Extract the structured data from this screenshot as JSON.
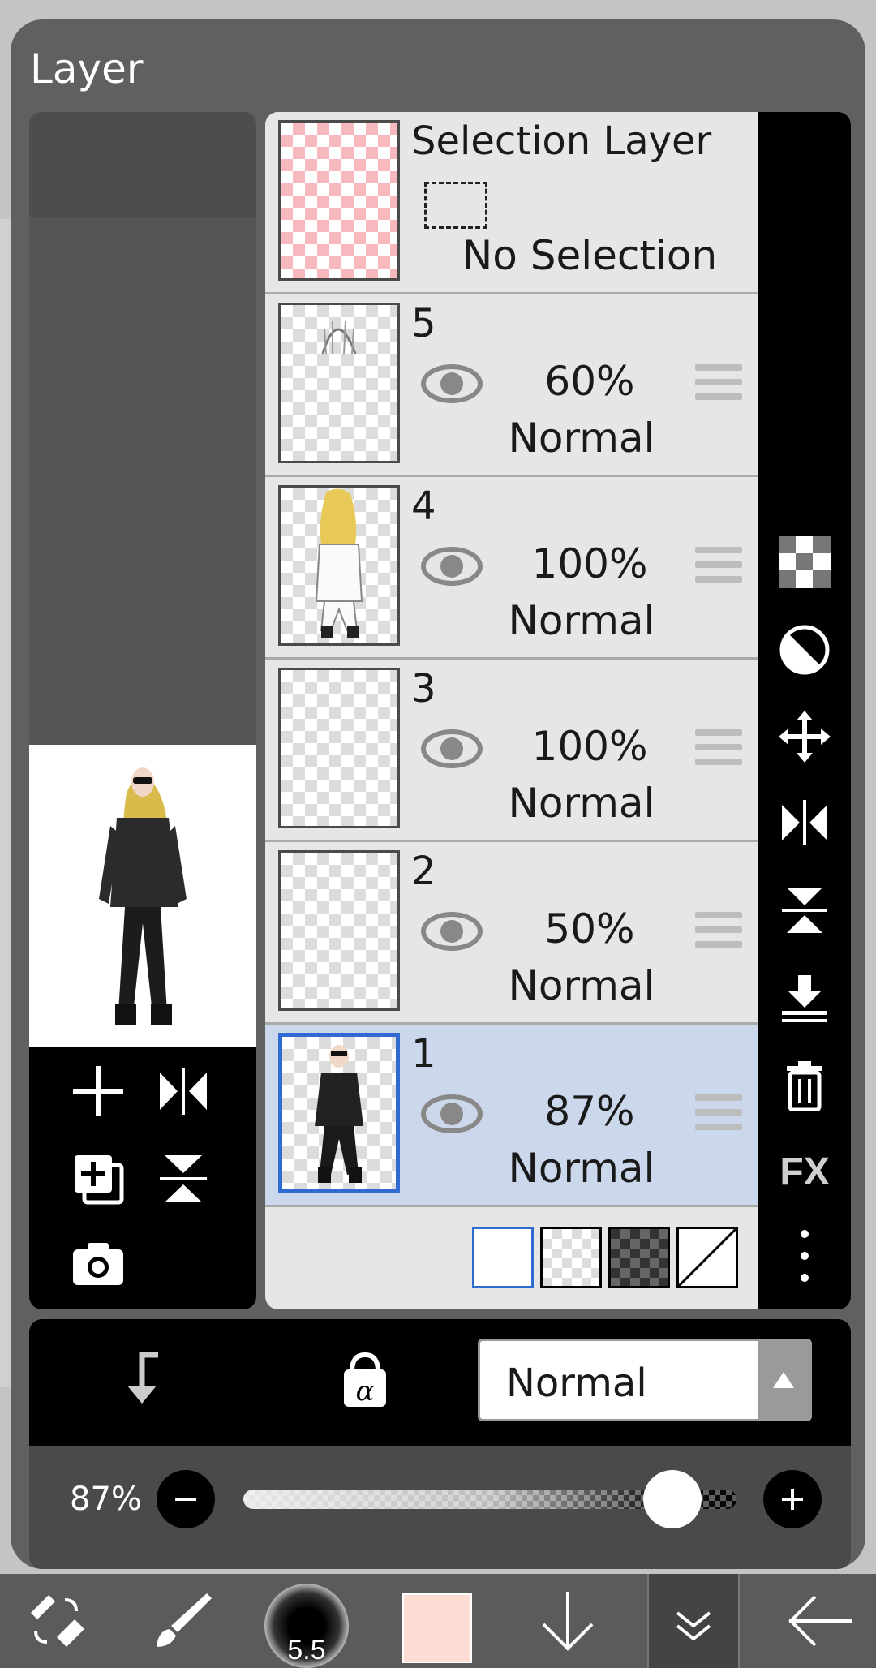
{
  "dialog": {
    "title": "Layer"
  },
  "selection_layer": {
    "title": "Selection Layer",
    "status": "No Selection"
  },
  "layers": [
    {
      "name": "5",
      "opacity": "60%",
      "blend": "Normal",
      "visible": true
    },
    {
      "name": "4",
      "opacity": "100%",
      "blend": "Normal",
      "visible": true
    },
    {
      "name": "3",
      "opacity": "100%",
      "blend": "Normal",
      "visible": true
    },
    {
      "name": "2",
      "opacity": "50%",
      "blend": "Normal",
      "visible": true
    },
    {
      "name": "1",
      "opacity": "87%",
      "blend": "Normal",
      "visible": true,
      "selected": true
    }
  ],
  "right_toolbar": {
    "fx_label": "FX"
  },
  "blend_mode": {
    "selected": "Normal"
  },
  "opacity_slider": {
    "label": "87%",
    "value_fraction": 0.87
  },
  "bottom_toolbar": {
    "brush_size": "5.5",
    "color": "#fcdcd3"
  },
  "colors": {
    "accent": "#2f6bd0",
    "selected_row": "#cbd7ea",
    "panel": "#606060"
  }
}
